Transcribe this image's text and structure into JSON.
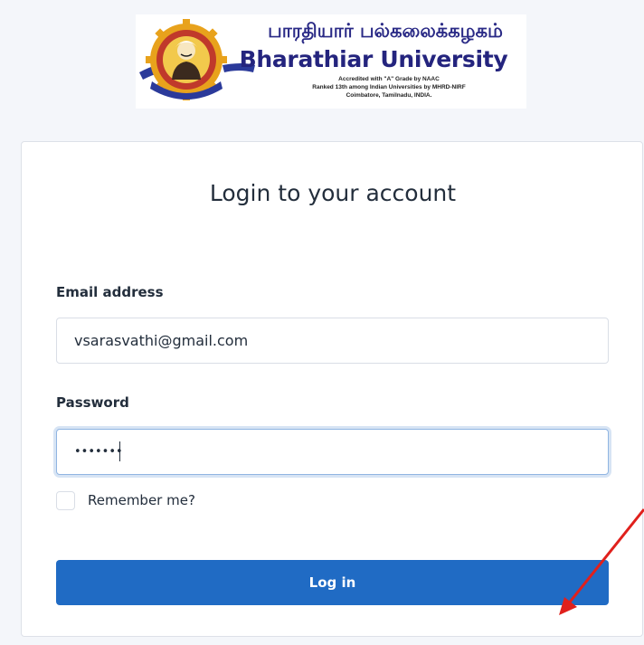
{
  "logo": {
    "tamil_name": "பாரதியார் பல்கலைக்கழகம்",
    "name": "Bharathiar University",
    "line1": "Accredited with \"A\" Grade by NAAC",
    "line2": "Ranked 13th among Indian Universities by MHRD-NIRF",
    "line3": "Coimbatore, Tamilnadu, INDIA."
  },
  "login": {
    "title": "Login to your account",
    "email_label": "Email address",
    "email_value": "vsarasvathi@gmail.com",
    "password_label": "Password",
    "password_value": "•••••••",
    "remember_label": "Remember me?",
    "remember_checked": false,
    "submit_label": "Log in"
  },
  "colors": {
    "page_background": "#f4f6fa",
    "primary_button": "#206bc4",
    "annotation_arrow": "#e0201c"
  }
}
